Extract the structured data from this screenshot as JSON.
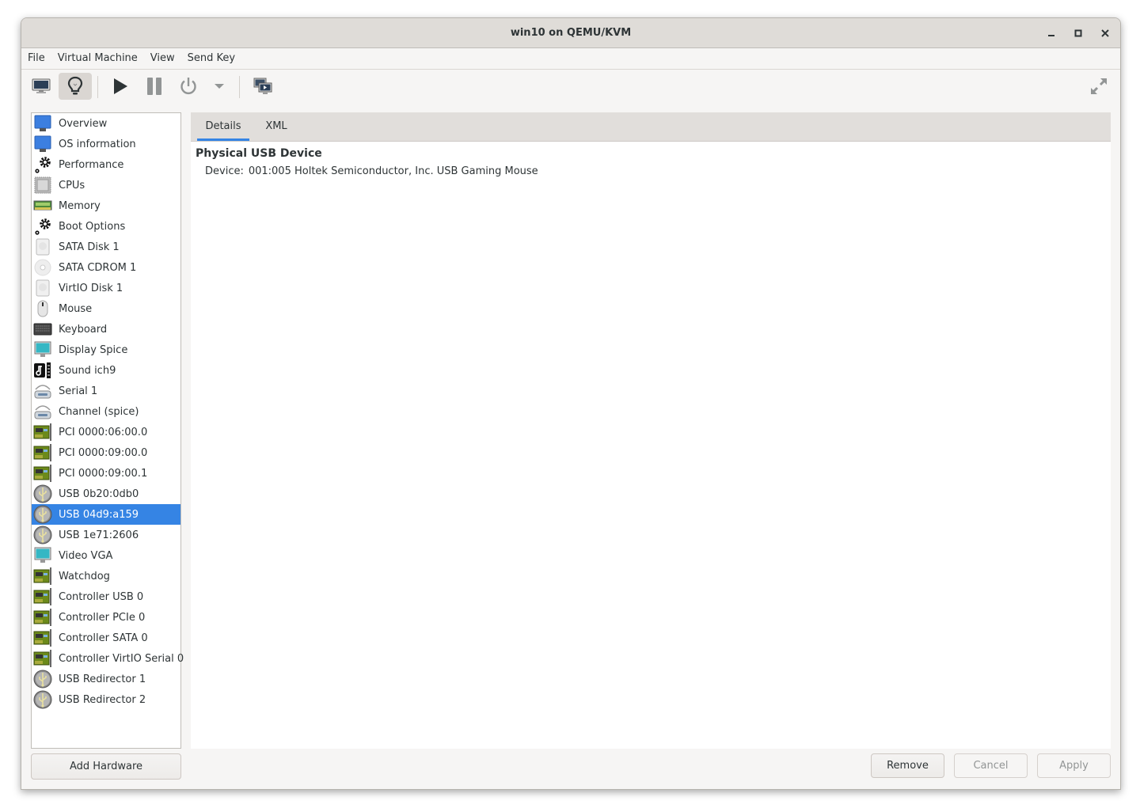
{
  "window": {
    "title": "win10 on QEMU/KVM",
    "controls": {
      "minimize": "minimize-icon",
      "maximize": "maximize-icon",
      "close": "close-icon"
    }
  },
  "menubar": [
    "File",
    "Virtual Machine",
    "View",
    "Send Key"
  ],
  "toolbar": {
    "buttons": [
      {
        "name": "console",
        "icon": "monitor-icon",
        "active": false
      },
      {
        "name": "details",
        "icon": "lightbulb-icon",
        "active": true
      },
      {
        "name": "run",
        "icon": "play-icon",
        "active": false
      },
      {
        "name": "pause",
        "icon": "pause-icon",
        "active": false
      },
      {
        "name": "shutdown",
        "icon": "power-icon",
        "active": false
      },
      {
        "name": "shutdown-menu",
        "icon": "chevron-down-icon",
        "active": false
      },
      {
        "name": "snapshots",
        "icon": "snapshots-icon",
        "active": false
      },
      {
        "name": "fullscreen",
        "icon": "fullscreen-icon",
        "active": false
      }
    ]
  },
  "hardware_list": {
    "selected_index": 19,
    "items": [
      {
        "label": "Overview",
        "icon": "monitor-blue"
      },
      {
        "label": "OS information",
        "icon": "monitor-blue"
      },
      {
        "label": "Performance",
        "icon": "gears"
      },
      {
        "label": "CPUs",
        "icon": "cpu"
      },
      {
        "label": "Memory",
        "icon": "memory"
      },
      {
        "label": "Boot Options",
        "icon": "gears"
      },
      {
        "label": "SATA Disk 1",
        "icon": "disk"
      },
      {
        "label": "SATA CDROM 1",
        "icon": "cdrom"
      },
      {
        "label": "VirtIO Disk 1",
        "icon": "disk"
      },
      {
        "label": "Mouse",
        "icon": "mouse"
      },
      {
        "label": "Keyboard",
        "icon": "keyboard"
      },
      {
        "label": "Display Spice",
        "icon": "display"
      },
      {
        "label": "Sound ich9",
        "icon": "sound"
      },
      {
        "label": "Serial 1",
        "icon": "serial"
      },
      {
        "label": "Channel (spice)",
        "icon": "serial"
      },
      {
        "label": "PCI 0000:06:00.0",
        "icon": "pci"
      },
      {
        "label": "PCI 0000:09:00.0",
        "icon": "pci"
      },
      {
        "label": "PCI 0000:09:00.1",
        "icon": "pci"
      },
      {
        "label": "USB 0b20:0db0",
        "icon": "usb"
      },
      {
        "label": "USB 04d9:a159",
        "icon": "usb"
      },
      {
        "label": "USB 1e71:2606",
        "icon": "usb"
      },
      {
        "label": "Video VGA",
        "icon": "display"
      },
      {
        "label": "Watchdog",
        "icon": "pci"
      },
      {
        "label": "Controller USB 0",
        "icon": "pci"
      },
      {
        "label": "Controller PCIe 0",
        "icon": "pci"
      },
      {
        "label": "Controller SATA 0",
        "icon": "pci"
      },
      {
        "label": "Controller VirtIO Serial 0",
        "icon": "pci"
      },
      {
        "label": "USB Redirector 1",
        "icon": "usb"
      },
      {
        "label": "USB Redirector 2",
        "icon": "usb"
      }
    ]
  },
  "add_hardware_label": "Add Hardware",
  "details": {
    "tabs": [
      {
        "label": "Details",
        "active": true
      },
      {
        "label": "XML",
        "active": false
      }
    ],
    "section_title": "Physical USB Device",
    "device_label": "Device:",
    "device_value": "001:005 Holtek Semiconductor, Inc. USB Gaming Mouse"
  },
  "actions": {
    "remove": "Remove",
    "cancel": "Cancel",
    "apply": "Apply",
    "cancel_enabled": false,
    "apply_enabled": false
  },
  "colors": {
    "accent": "#3584e4",
    "titlebar": "#dfdcd8",
    "window_bg": "#f6f5f4"
  }
}
